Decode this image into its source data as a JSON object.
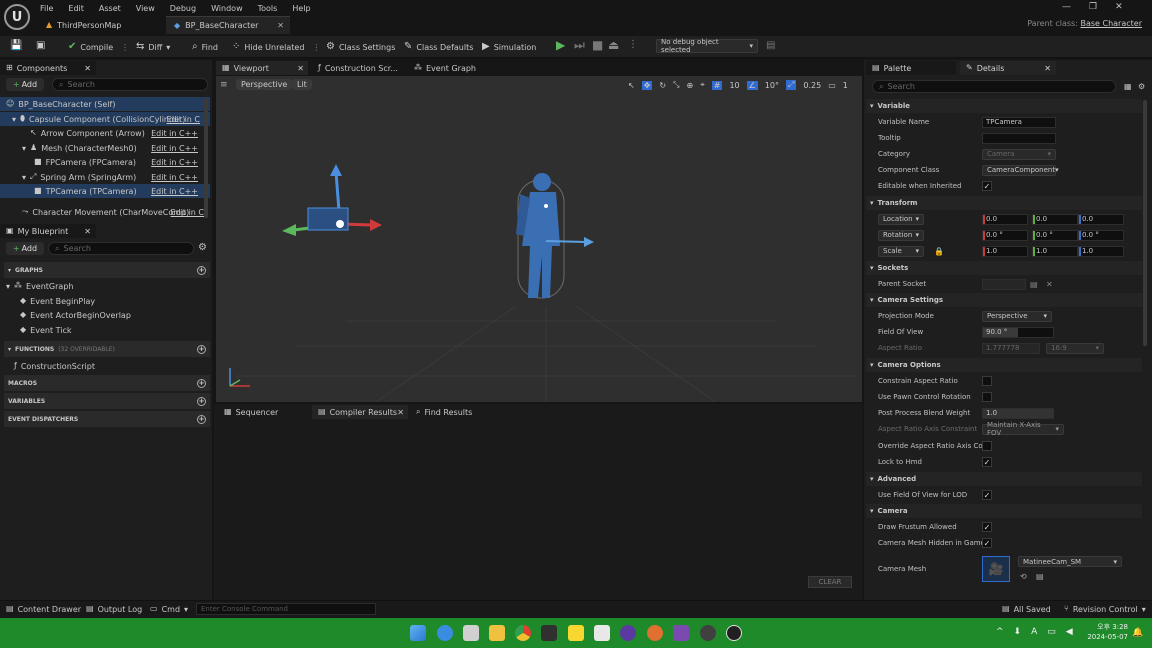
{
  "menu": [
    "File",
    "Edit",
    "Asset",
    "View",
    "Debug",
    "Window",
    "Tools",
    "Help"
  ],
  "doc_tabs": [
    {
      "label": "ThirdPersonMap"
    },
    {
      "label": "BP_BaseCharacter"
    }
  ],
  "parent_class": {
    "label": "Parent class:",
    "value": "Base Character"
  },
  "toolbar": {
    "compile": "Compile",
    "diff": "Diff",
    "find": "Find",
    "hide_unrelated": "Hide Unrelated",
    "class_settings": "Class Settings",
    "class_defaults": "Class Defaults",
    "simulation": "Simulation",
    "debug_object": "No debug object selected"
  },
  "components": {
    "title": "Components",
    "add": "Add",
    "search_placeholder": "Search",
    "items": [
      {
        "label": "BP_BaseCharacter (Self)",
        "edit": ""
      },
      {
        "label": "Capsule Component (CollisionCylinder)",
        "edit": "Edit in C"
      },
      {
        "label": "Arrow Component (Arrow)",
        "edit": "Edit in C++"
      },
      {
        "label": "Mesh (CharacterMesh0)",
        "edit": "Edit in C++"
      },
      {
        "label": "FPCamera (FPCamera)",
        "edit": "Edit in C++"
      },
      {
        "label": "Spring Arm (SpringArm)",
        "edit": "Edit in C++"
      },
      {
        "label": "TPCamera (TPCamera)",
        "edit": "Edit in C++"
      },
      {
        "label": "Character Movement (CharMoveComp)",
        "edit": "Edit in C"
      }
    ]
  },
  "my_blueprint": {
    "title": "My Blueprint",
    "add": "Add",
    "search_placeholder": "Search",
    "graphs_label": "GRAPHS",
    "event_graph": "EventGraph",
    "events": [
      "Event BeginPlay",
      "Event ActorBeginOverlap",
      "Event Tick"
    ],
    "functions_label": "FUNCTIONS",
    "functions_sub": "(32 OVERRIDABLE)",
    "construction": "ConstructionScript",
    "macros": "MACROS",
    "variables": "VARIABLES",
    "dispatchers": "EVENT DISPATCHERS"
  },
  "center_tabs": [
    "Viewport",
    "Construction Scr...",
    "Event Graph"
  ],
  "viewport": {
    "perspective": "Perspective",
    "lit": "Lit",
    "grid_snap": "10",
    "rot_snap": "10°",
    "scale_snap": "0.25",
    "cam_speed": "1"
  },
  "bottom_tabs": [
    "Sequencer",
    "Compiler Results",
    "Find Results"
  ],
  "clear": "CLEAR",
  "right_tabs": {
    "palette": "Palette",
    "details": "Details"
  },
  "details": {
    "search_placeholder": "Search",
    "sec_variable": "Variable",
    "variable_name_label": "Variable Name",
    "variable_name": "TPCamera",
    "tooltip_label": "Tooltip",
    "category_label": "Category",
    "category": "Camera",
    "component_class_label": "Component Class",
    "component_class": "CameraComponent",
    "editable_label": "Editable when Inherited",
    "sec_transform": "Transform",
    "location": "Location",
    "rotation": "Rotation",
    "scale": "Scale",
    "loc": [
      "0.0",
      "0.0",
      "0.0"
    ],
    "rot": [
      "0.0 °",
      "0.0 °",
      "0.0 °"
    ],
    "scl": [
      "1.0",
      "1.0",
      "1.0"
    ],
    "sec_sockets": "Sockets",
    "parent_socket_label": "Parent Socket",
    "sec_camera_settings": "Camera Settings",
    "projection_label": "Projection Mode",
    "projection": "Perspective",
    "fov_label": "Field Of View",
    "fov": "90.0 °",
    "aspect_label": "Aspect Ratio",
    "aspect": "1.777778",
    "aspect_preset": "16:9",
    "sec_camera_options": "Camera Options",
    "constrain_label": "Constrain Aspect Ratio",
    "pawn_control_label": "Use Pawn Control Rotation",
    "blend_label": "Post Process Blend Weight",
    "blend": "1.0",
    "axis_label": "Aspect Ratio Axis Constraint",
    "axis": "Maintain X-Axis FOV",
    "override_label": "Override Aspect Ratio Axis Co...",
    "lock_hmd_label": "Lock to Hmd",
    "sec_advanced": "Advanced",
    "lod_label": "Use Field Of View for LOD",
    "sec_camera": "Camera",
    "frustum_label": "Draw Frustum Allowed",
    "hidden_label": "Camera Mesh Hidden in Game",
    "mesh_label": "Camera Mesh",
    "mesh": "MatineeCam_SM"
  },
  "status": {
    "content_drawer": "Content Drawer",
    "output_log": "Output Log",
    "cmd": "Cmd",
    "console_placeholder": "Enter Console Command",
    "all_saved": "All Saved",
    "revision": "Revision Control"
  },
  "taskbar": {
    "time": "오후 3:28",
    "date": "2024-05-07",
    "ime": "A"
  }
}
